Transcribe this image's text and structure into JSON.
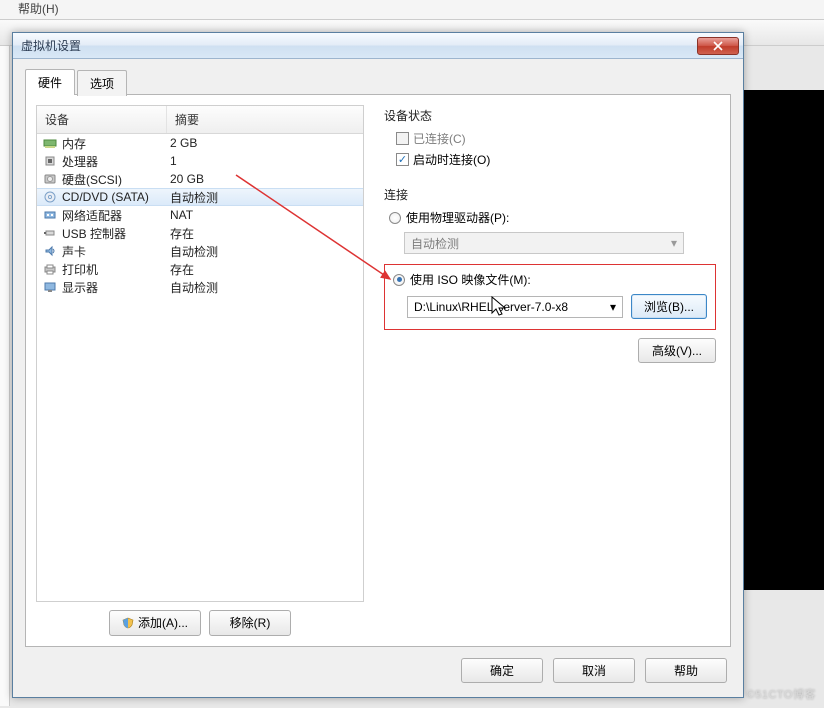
{
  "toolbar_menu": "帮助(H)",
  "dialog": {
    "title": "虚拟机设置",
    "tabs": {
      "hardware": "硬件",
      "options": "选项"
    },
    "headers": {
      "device": "设备",
      "summary": "摘要"
    },
    "devices": [
      {
        "name": "内存",
        "summary": "2 GB",
        "icon": "memory"
      },
      {
        "name": "处理器",
        "summary": "1",
        "icon": "cpu"
      },
      {
        "name": "硬盘(SCSI)",
        "summary": "20 GB",
        "icon": "disk"
      },
      {
        "name": "CD/DVD (SATA)",
        "summary": "自动检测",
        "icon": "cd",
        "selected": true
      },
      {
        "name": "网络适配器",
        "summary": "NAT",
        "icon": "net"
      },
      {
        "name": "USB 控制器",
        "summary": "存在",
        "icon": "usb"
      },
      {
        "name": "声卡",
        "summary": "自动检测",
        "icon": "sound"
      },
      {
        "name": "打印机",
        "summary": "存在",
        "icon": "printer"
      },
      {
        "name": "显示器",
        "summary": "自动检测",
        "icon": "display"
      }
    ],
    "add_btn": "添加(A)...",
    "remove_btn": "移除(R)",
    "status": {
      "title": "设备状态",
      "connected": "已连接(C)",
      "connect_on_power": "启动时连接(O)"
    },
    "connection": {
      "title": "连接",
      "physical": "使用物理驱动器(P):",
      "auto_detect": "自动检测",
      "use_iso": "使用 ISO 映像文件(M):",
      "iso_path": "D:\\Linux\\RHEL-server-7.0-x8",
      "browse": "浏览(B)..."
    },
    "advanced": "高级(V)...",
    "ok": "确定",
    "cancel": "取消",
    "help": "帮助"
  },
  "watermark": "©51CTO博客"
}
